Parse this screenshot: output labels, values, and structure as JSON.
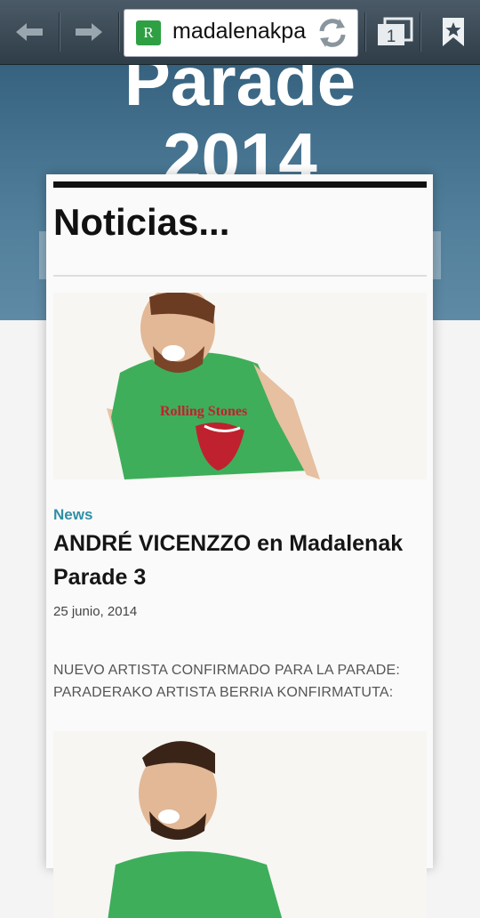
{
  "browser": {
    "url_text": "madalenakpa",
    "favicon_letter": "R",
    "tab_count": "1",
    "icons": [
      "back-arrow-icon",
      "forward-arrow-icon",
      "reload-icon",
      "tabs-icon",
      "bookmark-star-icon"
    ]
  },
  "hero": {
    "line1": "Parade",
    "line2": "2014"
  },
  "section": {
    "title": "Noticias..."
  },
  "post": {
    "category": "News",
    "title": "ANDRÉ VICENZZO en Madalenak Parade 3",
    "date": "25 junio, 2014",
    "excerpt": "NUEVO ARTISTA CONFIRMADO PARA LA PARADE: PARADERAKO ARTISTA BERRIA KONFIRMATUTA:"
  },
  "colors": {
    "toolbar": "#3b4a55",
    "accent": "#2f8fa5",
    "hero": "#4a7896"
  }
}
